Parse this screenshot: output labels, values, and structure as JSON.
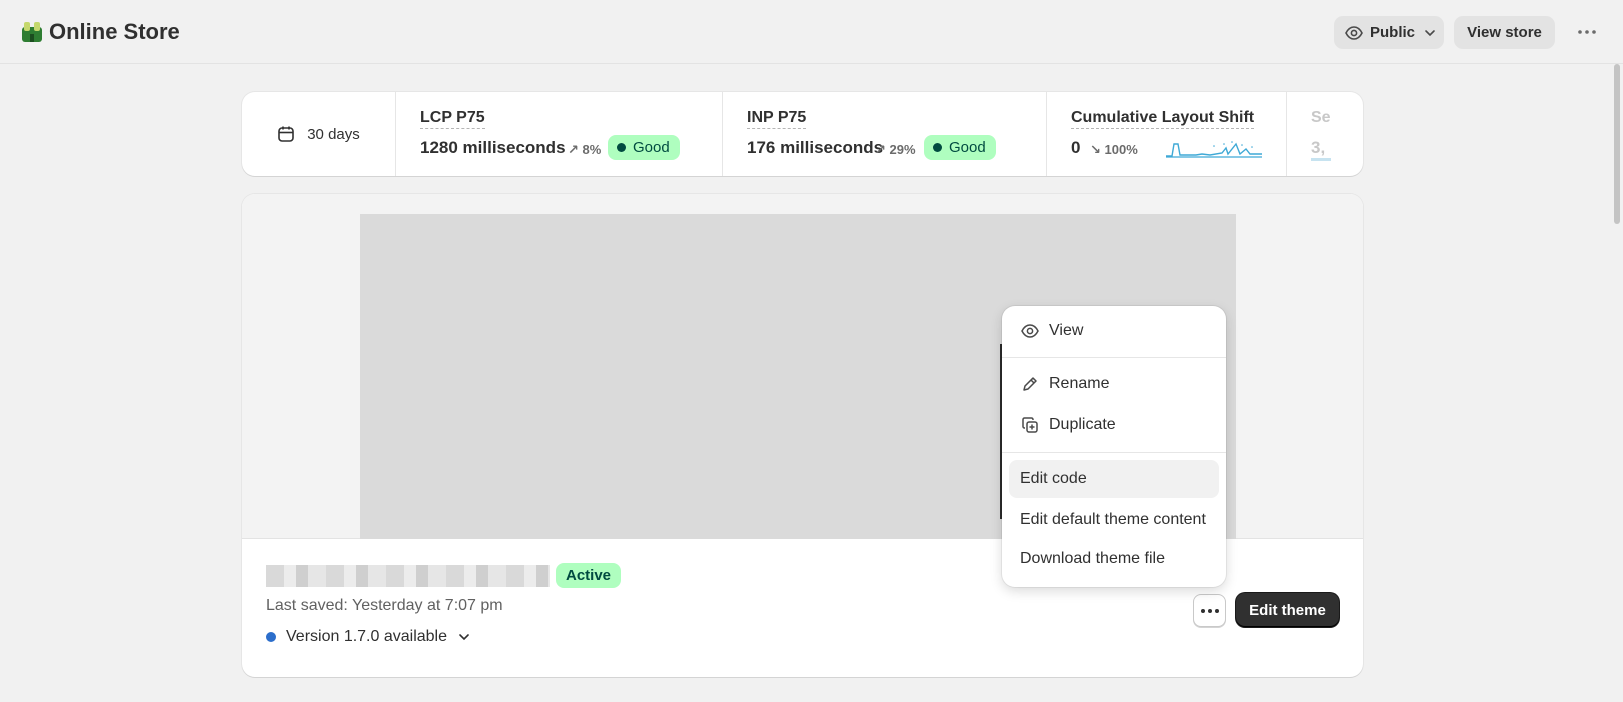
{
  "app": {
    "title": "Online Store"
  },
  "header": {
    "visibility_label": "Public",
    "view_store_label": "View store"
  },
  "metrics": {
    "period_label": "30 days",
    "lcp": {
      "label": "LCP P75",
      "value": "1280 milliseconds",
      "trend": "8%",
      "trend_direction": "up",
      "status": "Good"
    },
    "inp": {
      "label": "INP P75",
      "value": "176 milliseconds",
      "trend": "29%",
      "trend_direction": "up",
      "status": "Good"
    },
    "cls": {
      "label": "Cumulative Layout Shift",
      "value": "0",
      "trend": "100%",
      "trend_direction": "down"
    },
    "next": {
      "label": "Se",
      "value": "3,"
    }
  },
  "theme": {
    "status_badge": "Active",
    "last_saved": "Last saved: Yesterday at 7:07 pm",
    "version_text": "Version 1.7.0 available",
    "edit_button": "Edit theme"
  },
  "menu": {
    "items": [
      {
        "label": "View",
        "icon": "eye-icon"
      },
      {
        "label": "Rename",
        "icon": "pencil-icon"
      },
      {
        "label": "Duplicate",
        "icon": "duplicate-icon"
      },
      {
        "label": "Edit code"
      },
      {
        "label": "Edit default theme content"
      },
      {
        "label": "Download theme file"
      }
    ]
  },
  "colors": {
    "good_badge_bg": "#affebf",
    "good_badge_text": "#014b40",
    "primary_button": "#303030",
    "version_dot": "#2c6ecb",
    "sparkline": "#3fa9d6"
  }
}
